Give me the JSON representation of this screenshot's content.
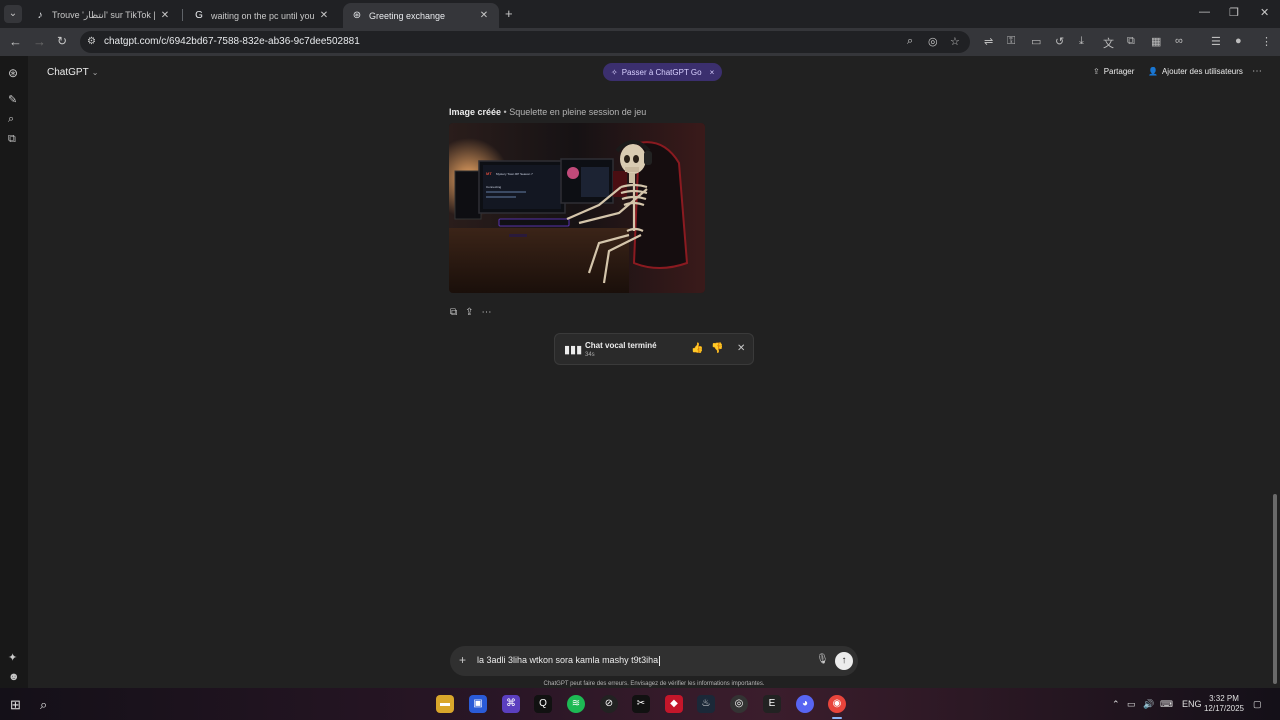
{
  "browser": {
    "tabs": [
      {
        "title": "Trouve 'انتظار' sur TikTok | Reche",
        "favicon": "tiktok-icon"
      },
      {
        "title": "waiting on the pc until you be a",
        "favicon": "google-icon"
      },
      {
        "title": "Greeting exchange",
        "favicon": "openai-icon"
      }
    ],
    "url": "chatgpt.com/c/6942bd67-7588-832e-ab36-9c7dee502881"
  },
  "app": {
    "model_label": "ChatGPT",
    "upgrade_pill": "Passer à ChatGPT Go",
    "share_label": "Partager",
    "add_users_label": "Ajouter des utilisateurs"
  },
  "conversation": {
    "image_caption_label": "Image créée",
    "image_caption_sep": " • ",
    "image_caption_title": "Squelette en pleine session de jeu",
    "image_screen_text": "Mystery Town RP Season 7",
    "image_screen_sub": "Connecting"
  },
  "voice_card": {
    "title": "Chat vocal terminé",
    "duration": "34s"
  },
  "composer": {
    "text": "la 3adli 3liha wtkon sora kamla mashy t9t3iha",
    "disclaimer": "ChatGPT peut faire des erreurs. Envisagez de vérifier les informations importantes."
  },
  "taskbar": {
    "lang": "ENG",
    "time": "3:32 PM",
    "date": "12/17/2025"
  },
  "colors": {
    "bg": "#212121",
    "rail": "#181818",
    "pill": "#3b2f6e",
    "composer": "#303030"
  }
}
